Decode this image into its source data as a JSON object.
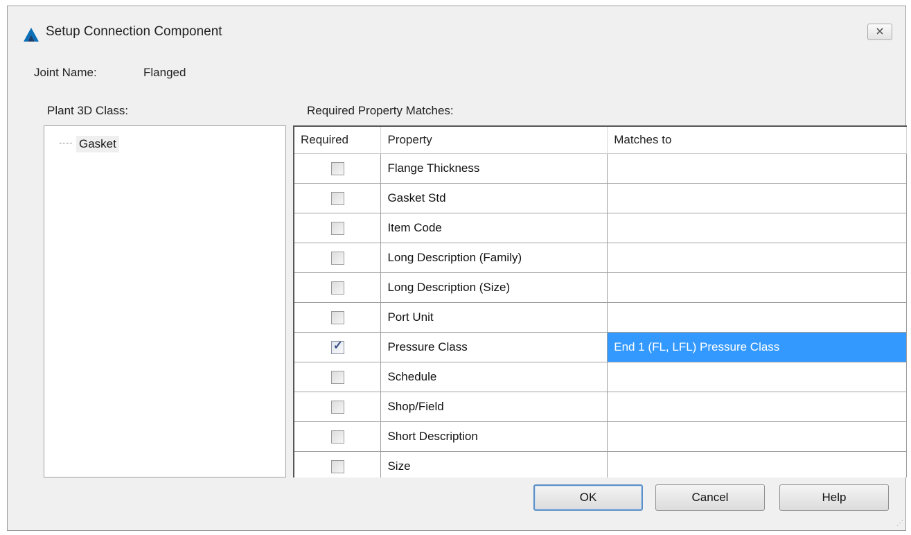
{
  "window": {
    "title": "Setup Connection Component",
    "icon": "autodesk-logo-icon",
    "close_icon": "close-icon"
  },
  "joint": {
    "label": "Joint Name:",
    "value": "Flanged"
  },
  "class_panel": {
    "label": "Plant 3D Class:",
    "items": [
      {
        "label": "Gasket"
      }
    ]
  },
  "matches_panel": {
    "label": "Required Property Matches:",
    "columns": [
      "Required",
      "Property",
      "Matches to"
    ],
    "rows": [
      {
        "required": false,
        "property": "Flange Thickness",
        "matches_to": ""
      },
      {
        "required": false,
        "property": "Gasket Std",
        "matches_to": ""
      },
      {
        "required": false,
        "property": "Item Code",
        "matches_to": ""
      },
      {
        "required": false,
        "property": "Long Description (Family)",
        "matches_to": ""
      },
      {
        "required": false,
        "property": "Long Description (Size)",
        "matches_to": ""
      },
      {
        "required": false,
        "property": "Port Unit",
        "matches_to": ""
      },
      {
        "required": true,
        "property": "Pressure Class",
        "matches_to": "End 1 (FL, LFL) Pressure Class",
        "selected": true
      },
      {
        "required": false,
        "property": "Schedule",
        "matches_to": ""
      },
      {
        "required": false,
        "property": "Shop/Field",
        "matches_to": ""
      },
      {
        "required": false,
        "property": "Short Description",
        "matches_to": ""
      },
      {
        "required": false,
        "property": "Size",
        "matches_to": ""
      }
    ]
  },
  "buttons": {
    "ok": "OK",
    "cancel": "Cancel",
    "help": "Help"
  },
  "colors": {
    "selection": "#3399ff",
    "dialog_bg": "#f0f0f0",
    "logo": "#0a6fb8"
  }
}
